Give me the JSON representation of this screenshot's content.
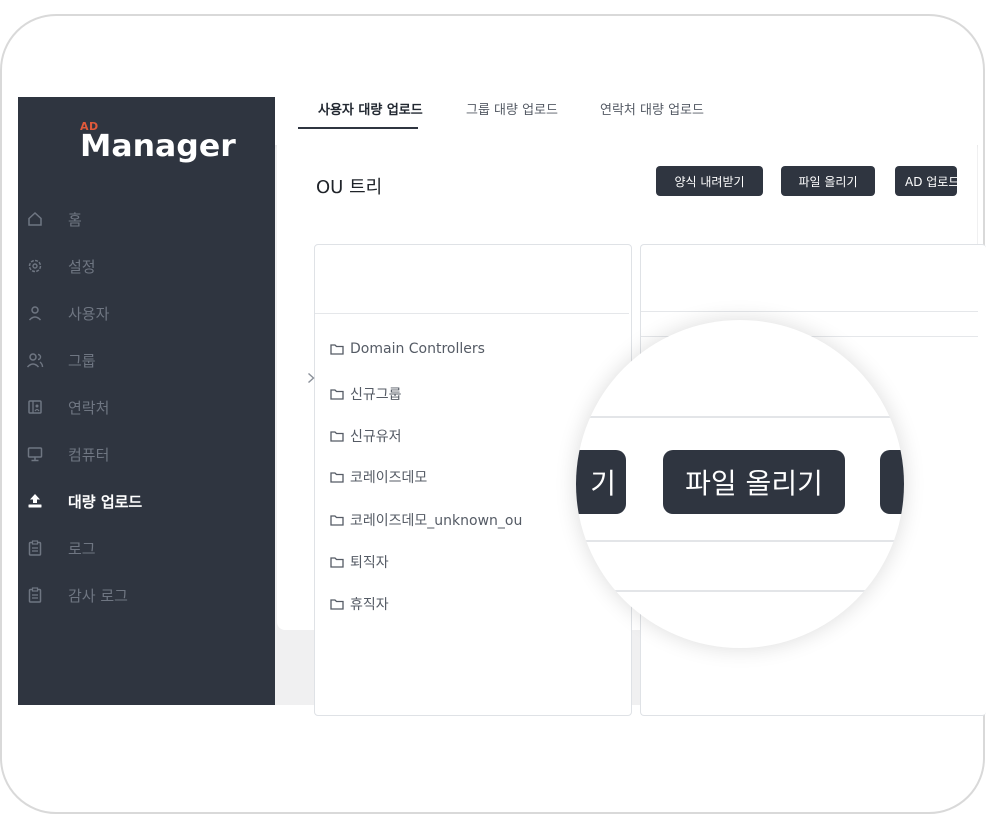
{
  "logo": {
    "small": "AD",
    "name": "Manager"
  },
  "sidebar": {
    "items": [
      {
        "label": "홈",
        "icon": "home-icon",
        "active": false
      },
      {
        "label": "설정",
        "icon": "settings-icon",
        "active": false
      },
      {
        "label": "사용자",
        "icon": "user-icon",
        "active": false
      },
      {
        "label": "그룹",
        "icon": "group-icon",
        "active": false
      },
      {
        "label": "연락처",
        "icon": "contacts-icon",
        "active": false
      },
      {
        "label": "컴퓨터",
        "icon": "computer-icon",
        "active": false
      },
      {
        "label": "대량 업로드",
        "icon": "upload-icon",
        "active": true
      },
      {
        "label": "로그",
        "icon": "clipboard-icon",
        "active": false
      },
      {
        "label": "감사 로그",
        "icon": "clipboard-icon",
        "active": false
      }
    ]
  },
  "tabs": [
    {
      "label": "사용자 대량 업로드",
      "active": true
    },
    {
      "label": "그룹 대량 업로드",
      "active": false
    },
    {
      "label": "연락처 대량 업로드",
      "active": false
    }
  ],
  "ou_tree": {
    "title": "OU 트리",
    "items": [
      {
        "label": "Domain Controllers",
        "expandable": false
      },
      {
        "label": "신규그룹",
        "expandable": false
      },
      {
        "label": "신규유저",
        "expandable": false
      },
      {
        "label": "코레이즈데모",
        "expandable": true
      },
      {
        "label": "코레이즈데모_unknown_ou",
        "expandable": false
      },
      {
        "label": "퇴직자",
        "expandable": false
      },
      {
        "label": "휴직자",
        "expandable": false
      }
    ]
  },
  "toolbar": {
    "download_template": "양식 내려받기",
    "upload_file": "파일 올리기",
    "ad_upload": "AD 업로드"
  },
  "magnifier": {
    "left_fragment": "기",
    "center_label": "파일 올리기"
  },
  "colors": {
    "sidebar_bg": "#2f3540",
    "accent": "#e05a3b",
    "button_bg": "#2f3540"
  }
}
